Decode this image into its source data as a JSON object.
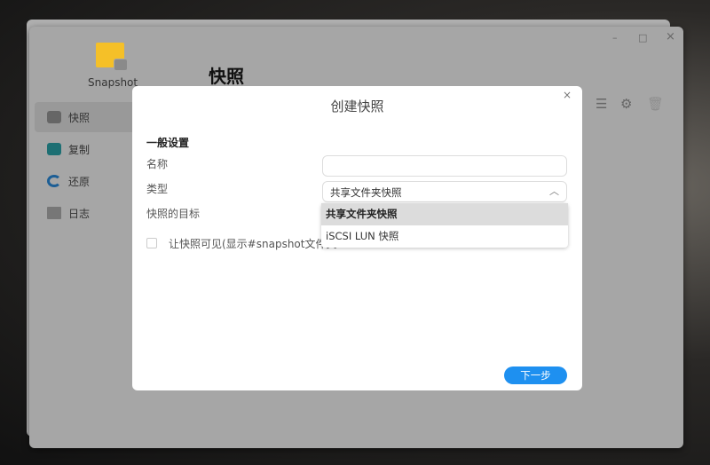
{
  "app": {
    "name": "Snapshot",
    "heading": "快照"
  },
  "window_controls": {
    "minimize": "–",
    "maximize": "□",
    "close": "×"
  },
  "sidebar": {
    "items": [
      {
        "label": "快照",
        "icon": "camera-icon",
        "active": true
      },
      {
        "label": "复制",
        "icon": "replicate-icon"
      },
      {
        "label": "还原",
        "icon": "restore-icon"
      },
      {
        "label": "日志",
        "icon": "log-icon"
      }
    ]
  },
  "toolbar": {
    "icons": [
      "list-icon",
      "gear-icon",
      "trash-icon"
    ]
  },
  "dialog": {
    "title": "创建快照",
    "close": "×",
    "section": "一般设置",
    "name_label": "名称",
    "name_value": "",
    "type_label": "类型",
    "type_value": "共享文件夹快照",
    "target_label": "快照的目标",
    "type_options": [
      "共享文件夹快照",
      "iSCSI LUN 快照"
    ],
    "visible_checkbox_label": "让快照可见(显示#snapshot文件夹",
    "visible_checked": false,
    "next_button": "下一步"
  },
  "colors": {
    "accent": "#1e90f0",
    "folder": "#f5c028"
  }
}
